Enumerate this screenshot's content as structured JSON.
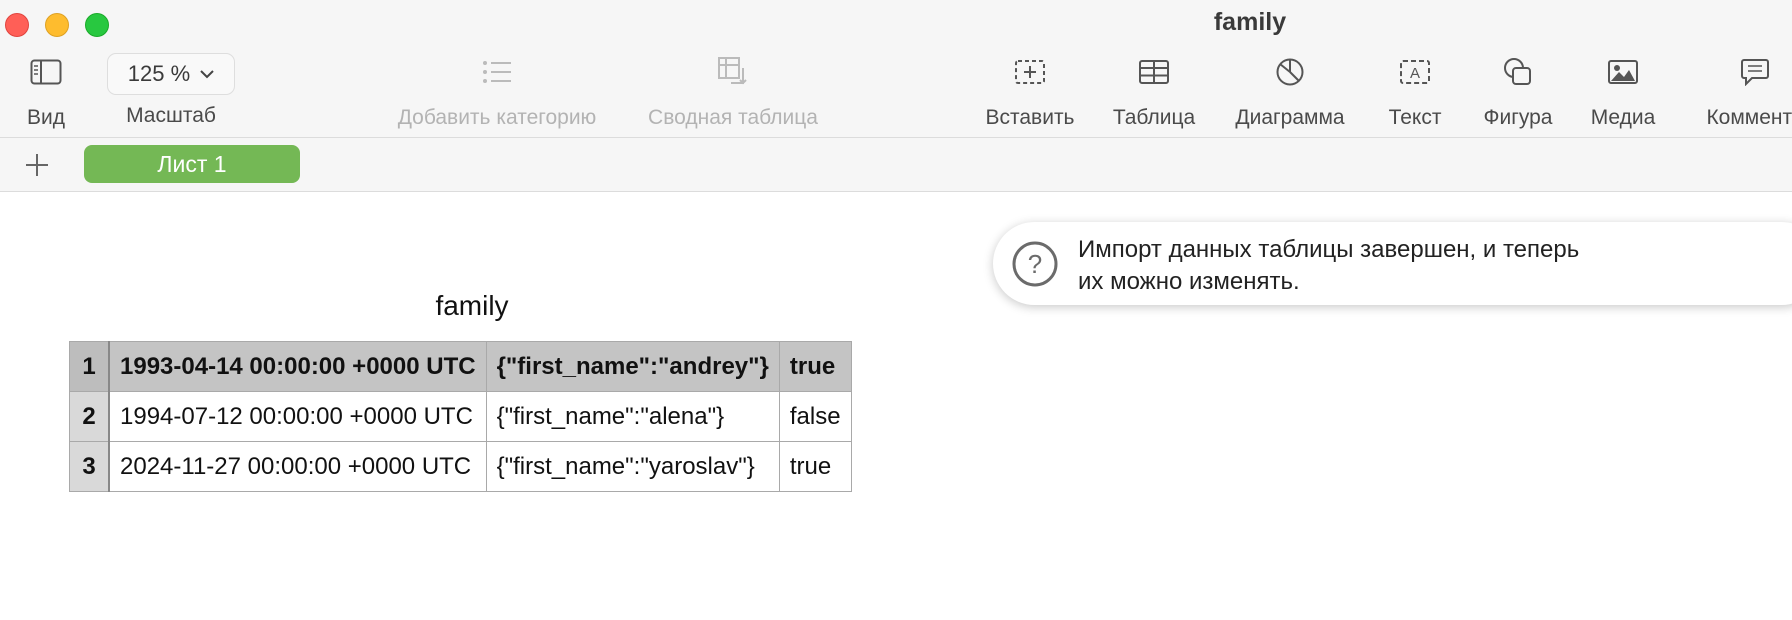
{
  "window": {
    "title": "family"
  },
  "toolbar": {
    "view_label": "Вид",
    "zoom_value": "125 %",
    "zoom_label": "Масштаб",
    "add_category_label": "Добавить категорию",
    "pivot_table_label": "Сводная таблица",
    "insert_label": "Вставить",
    "table_label": "Таблица",
    "chart_label": "Диаграмма",
    "text_label": "Текст",
    "shape_label": "Фигура",
    "media_label": "Медиа",
    "comment_label": "Коммента"
  },
  "sheets": {
    "active": "Лист 1"
  },
  "table": {
    "title": "family",
    "rows": [
      {
        "num": "1",
        "date": "1993-04-14 00:00:00 +0000 UTC",
        "json": "{\"first_name\":\"andrey\"}",
        "flag": "true"
      },
      {
        "num": "2",
        "date": "1994-07-12 00:00:00 +0000 UTC",
        "json": "{\"first_name\":\"alena\"}",
        "flag": "false"
      },
      {
        "num": "3",
        "date": "2024-11-27 00:00:00 +0000 UTC",
        "json": "{\"first_name\":\"yaroslav\"}",
        "flag": "true"
      }
    ]
  },
  "notification": {
    "line1": "Импорт данных таблицы завершен, и теперь",
    "line2": "их можно изменять."
  },
  "colors": {
    "sheet_tab": "#74b855",
    "close": "#ff5f57",
    "minimize": "#febc2e",
    "maximize": "#28c840"
  }
}
